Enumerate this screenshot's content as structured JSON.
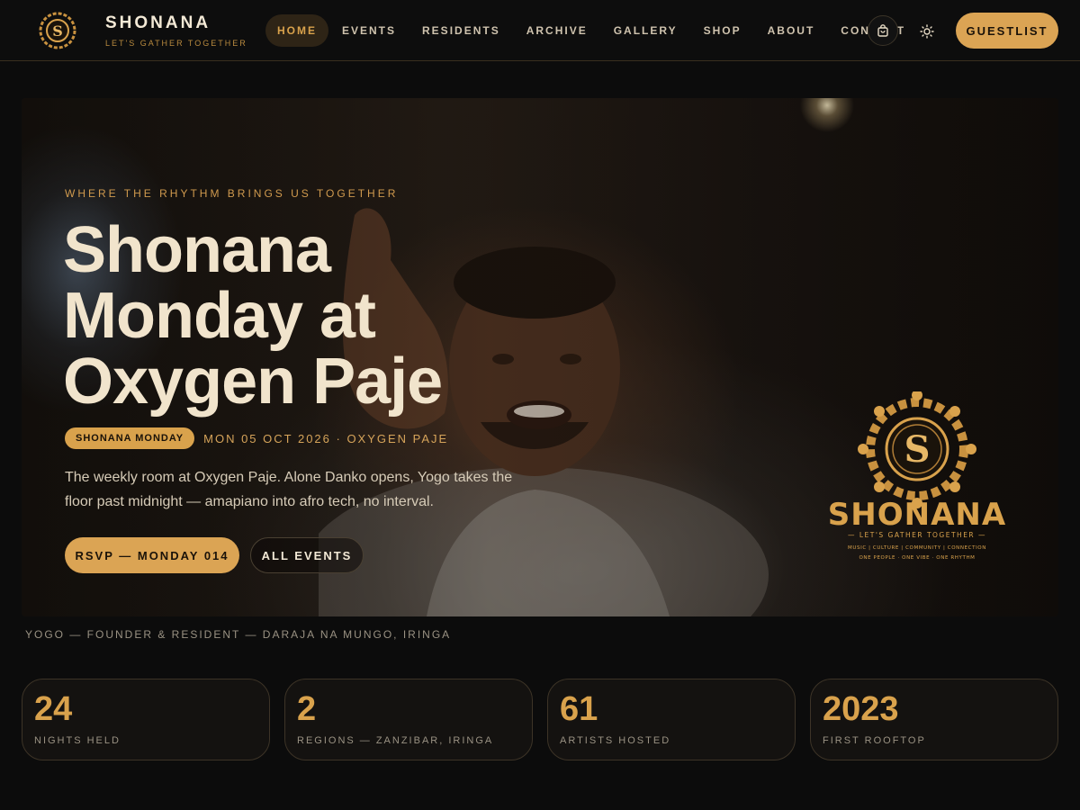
{
  "brand": {
    "name": "SHONANA",
    "tagline": "LET'S GATHER TOGETHER"
  },
  "nav": {
    "items": [
      {
        "label": "HOME",
        "active": true
      },
      {
        "label": "EVENTS"
      },
      {
        "label": "RESIDENTS"
      },
      {
        "label": "ARCHIVE"
      },
      {
        "label": "GALLERY"
      },
      {
        "label": "SHOP"
      },
      {
        "label": "ABOUT"
      },
      {
        "label": "CONTACT"
      }
    ],
    "cart_icon": "shopping-bag-icon",
    "theme_icon": "sun-icon",
    "guestlist_label": "GUESTLIST"
  },
  "hero": {
    "eyebrow": "WHERE THE RHYTHM BRINGS US TOGETHER",
    "title": "Shonana Monday at Oxygen Paje",
    "series_badge": "SHONANA MONDAY",
    "event_meta": "MON 05 OCT 2026 · OXYGEN PAJE",
    "description": "The weekly room at Oxygen Paje. Alone Danko opens, Yogo takes the floor past midnight — amapiano into afro tech, no interval.",
    "rsvp_label": "RSVP — MONDAY 014",
    "all_events_label": "ALL EVENTS",
    "emblem": {
      "name": "SHONANA",
      "tagline": "— LET'S GATHER TOGETHER —",
      "pillars": "MUSIC | CULTURE | COMMUNITY | CONNECTION",
      "motto": "ONE PEOPLE · ONE VIBE · ONE RHYTHM"
    }
  },
  "caption": "YOGO — FOUNDER & RESIDENT — DARAJA NA MUNGO, IRINGA",
  "stats": [
    {
      "value": "24",
      "label": "NIGHTS HELD"
    },
    {
      "value": "2",
      "label": "REGIONS — ZANZIBAR, IRINGA"
    },
    {
      "value": "61",
      "label": "ARTISTS HOSTED"
    },
    {
      "value": "2023",
      "label": "FIRST ROOFTOP"
    }
  ],
  "colors": {
    "accent": "#dba454",
    "background": "#0c0c0c",
    "text": "#f1e4cc"
  }
}
